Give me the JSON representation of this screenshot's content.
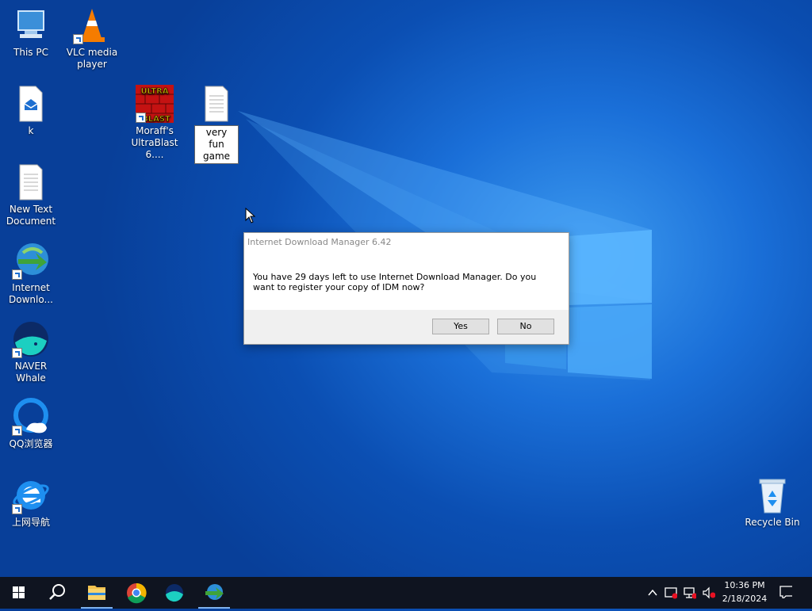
{
  "desktop": {
    "icons": [
      {
        "label": "This PC",
        "icon": "this-pc-icon"
      },
      {
        "label": "VLC media player",
        "icon": "vlc-icon"
      },
      {
        "label": "k",
        "icon": "mail-doc-icon"
      },
      {
        "label": "Moraff's UltraBlast 6....",
        "icon": "ultrablast-icon"
      },
      {
        "label": "New Text Document",
        "icon": "text-document-icon"
      },
      {
        "label": "Internet Downlo...",
        "icon": "idm-icon"
      },
      {
        "label": "NAVER Whale",
        "icon": "naver-whale-icon"
      },
      {
        "label": "QQ浏览器",
        "icon": "qq-browser-icon"
      },
      {
        "label": "上网导航",
        "icon": "ie-navigation-icon"
      },
      {
        "label": "Recycle Bin",
        "icon": "recycle-bin-icon"
      }
    ],
    "rename": {
      "value": "very fun game",
      "icon": "text-document-icon"
    },
    "ultrablast_logo": "ULTRA BLAST"
  },
  "dialog": {
    "title": "Internet Download Manager 6.42",
    "message": "You have 29 days left to use Internet Download Manager. Do you want to register your copy of IDM now?",
    "yes_label": "Yes",
    "no_label": "No"
  },
  "taskbar": {
    "pinned": [
      "start-icon",
      "search-icon",
      "file-explorer-icon",
      "chrome-icon",
      "naver-whale-icon",
      "idm-icon"
    ],
    "tray_icons": [
      "chevron-up-icon",
      "security-icon",
      "network-icon",
      "volume-muted-icon",
      "notification-icon"
    ],
    "time": "10:36 PM",
    "date": "2/18/2024"
  },
  "colors": {
    "desktop_blue": "#0b4fb3",
    "taskbar": "#0f1420",
    "dialog_footer": "#f0f0f0"
  }
}
